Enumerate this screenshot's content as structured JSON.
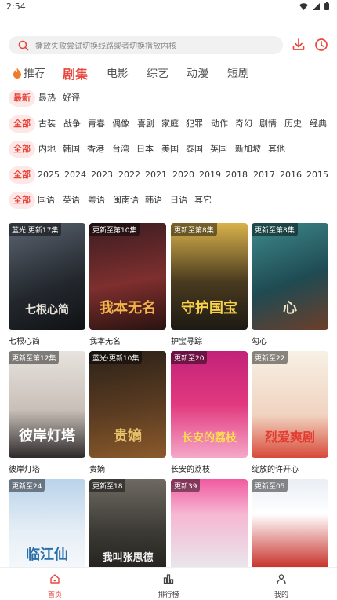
{
  "status_bar": {
    "time": "2:54"
  },
  "search": {
    "placeholder": "播放失败尝试切换线路或者切换播放内核"
  },
  "tabs": [
    {
      "label": "推荐"
    },
    {
      "label": "剧集"
    },
    {
      "label": "电影"
    },
    {
      "label": "综艺"
    },
    {
      "label": "动漫"
    },
    {
      "label": "短剧"
    }
  ],
  "filters": {
    "sort": [
      "最新",
      "最热",
      "好评"
    ],
    "genre": [
      "全部",
      "古装",
      "战争",
      "青春",
      "偶像",
      "喜剧",
      "家庭",
      "犯罪",
      "动作",
      "奇幻",
      "剧情",
      "历史",
      "经典"
    ],
    "region": [
      "全部",
      "内地",
      "韩国",
      "香港",
      "台湾",
      "日本",
      "美国",
      "泰国",
      "英国",
      "新加坡",
      "其他"
    ],
    "year": [
      "全部",
      "2025",
      "2024",
      "2023",
      "2022",
      "2021",
      "2020",
      "2019",
      "2018",
      "2017",
      "2016",
      "2015"
    ],
    "language": [
      "全部",
      "国语",
      "英语",
      "粤语",
      "闽南语",
      "韩语",
      "日语",
      "其它"
    ]
  },
  "cards": [
    {
      "badge": "蓝光·更新17集",
      "title": "七根心简",
      "art": "七根心简"
    },
    {
      "badge": "更新至第10集",
      "title": "我本无名",
      "art": "我本无名"
    },
    {
      "badge": "更新至第8集",
      "title": "护宝寻踪",
      "art": "守护国宝"
    },
    {
      "badge": "更新至第8集",
      "title": "勾心",
      "art": "心"
    },
    {
      "badge": "更新至第12集",
      "title": "彼岸灯塔",
      "art": "彼岸灯塔"
    },
    {
      "badge": "蓝光·更新10集",
      "title": "贵嫡",
      "art": "贵嫡"
    },
    {
      "badge": "更新至20",
      "title": "长安的荔枝",
      "art": "长安的荔枝"
    },
    {
      "badge": "更新至22",
      "title": "绽放的许开心",
      "art": "烈爱爽剧"
    },
    {
      "badge": "更新至24",
      "title": "",
      "art": "临江仙"
    },
    {
      "badge": "更新至18",
      "title": "",
      "art": "我叫张思德"
    },
    {
      "badge": "更新39",
      "title": "",
      "art": ""
    },
    {
      "badge": "更新至05",
      "title": "",
      "art": ""
    }
  ],
  "bottom_nav": [
    {
      "label": "首页"
    },
    {
      "label": "排行榜"
    },
    {
      "label": "我的"
    }
  ],
  "colors": {
    "accent": "#e8453c",
    "chip_bg": "#fde8e7",
    "search_bg": "#f1f1f1"
  }
}
